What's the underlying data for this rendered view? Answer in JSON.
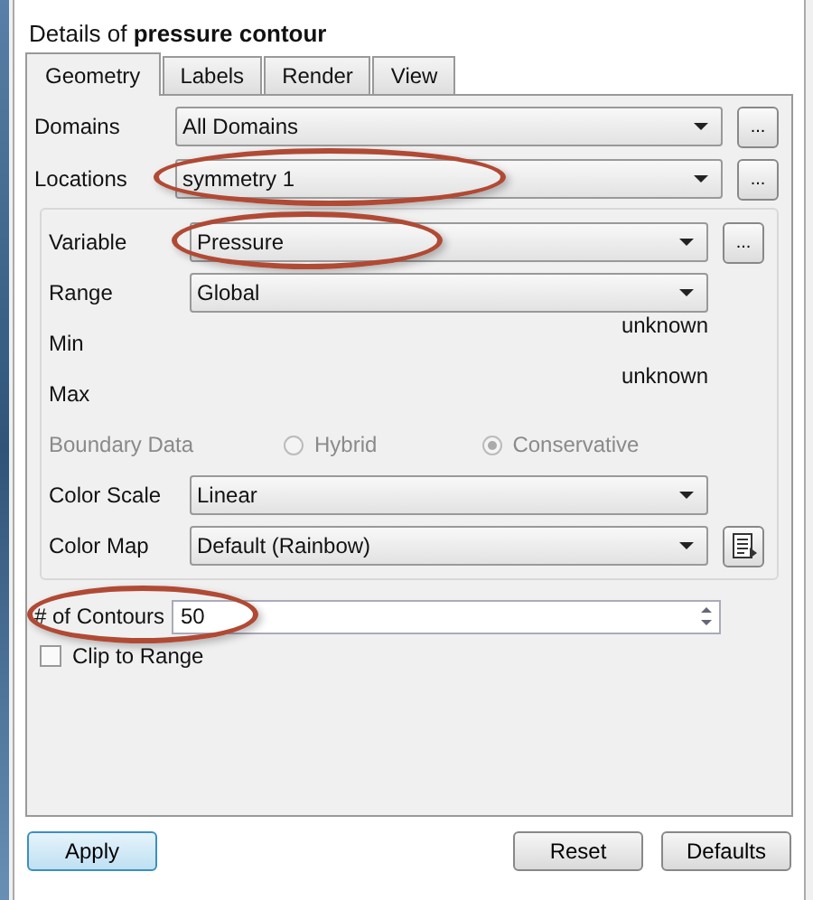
{
  "window": {
    "title": "Details of **pressure contour**"
  },
  "tabs": [
    {
      "label": "Geometry",
      "selected": true
    },
    {
      "label": "Labels",
      "selected": false
    },
    {
      "label": "Render",
      "selected": false
    },
    {
      "label": "View",
      "selected": false
    }
  ],
  "rows": [
    {
      "kind": "combo",
      "label": "Domains",
      "value": "All Domains",
      "button": {
        "kind": "text",
        "label": "..."
      },
      "highlighted": false
    },
    {
      "kind": "combo",
      "label": "Locations",
      "value": "symmetry 1",
      "button": {
        "kind": "text",
        "label": "..."
      },
      "highlighted": true
    }
  ],
  "group": [
    {
      "kind": "combo",
      "label": "Variable",
      "value": "Pressure",
      "button": {
        "kind": "text",
        "label": "..."
      },
      "highlighted": true
    },
    {
      "kind": "combo",
      "label": "Range",
      "value": "Global",
      "highlighted": false
    },
    {
      "kind": "readout",
      "label": "Min",
      "value": "unknown"
    },
    {
      "kind": "readout",
      "label": "Max",
      "value": "unknown"
    },
    {
      "kind": "radio",
      "label": "Boundary Data",
      "disabled": true,
      "options": [
        {
          "label": "Hybrid",
          "selected": false
        },
        {
          "label": "Conservative",
          "selected": true
        }
      ]
    },
    {
      "kind": "combo",
      "label": "Color Scale",
      "value": "Linear",
      "highlighted": false
    },
    {
      "kind": "combo",
      "label": "Color Map",
      "value": "Default (Rainbow)",
      "button": {
        "kind": "icon"
      },
      "highlighted": false
    }
  ],
  "contours": {
    "label": "# of Contours",
    "value": "50",
    "highlighted": true
  },
  "clip": {
    "label": "Clip to Range",
    "checked": false
  },
  "buttons": [
    {
      "label": "Apply",
      "default": true
    },
    {
      "label": "Reset",
      "default": false
    },
    {
      "label": "Defaults",
      "default": false
    }
  ]
}
